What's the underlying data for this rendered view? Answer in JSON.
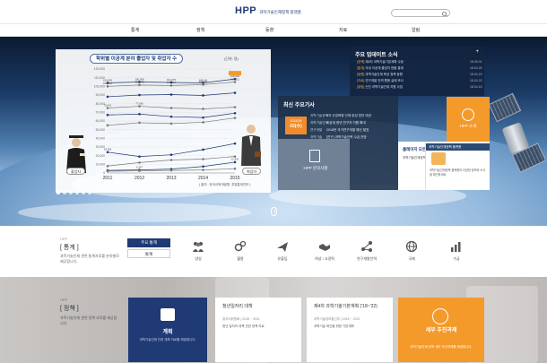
{
  "header": {
    "logo_mark": "HPP",
    "logo_sub": "과학기술인재정책 플랫폼"
  },
  "nav": {
    "items": [
      "통계",
      "정책",
      "동향",
      "자료",
      "알림"
    ]
  },
  "chart_panel": {
    "title": "학위별 이공계 분야 졸업자 및 취업자 수",
    "unit": "(단위: 명)",
    "source": "( 출처 : 한국교육개발원, 취업통계연보 )",
    "graduates_label": "졸업자",
    "employed_label": "취업자"
  },
  "chart_data": {
    "type": "line",
    "x": [
      "2011",
      "2012",
      "2013",
      "2014",
      "2015"
    ],
    "ylim": [
      0,
      120000
    ],
    "yticks": [
      "0",
      "10,000",
      "20,000",
      "30,000",
      "40,000",
      "50,000",
      "60,000",
      "70,000",
      "80,000",
      "90,000",
      "100,000",
      "110,000",
      "120,000"
    ],
    "series": [
      {
        "values": [
          104000,
          105000,
          104500,
          104000,
          108500
        ]
      },
      {
        "values": [
          100000,
          101500,
          101000,
          102000,
          105000
        ]
      },
      {
        "values": [
          88000,
          90000,
          90500,
          89500,
          92500
        ]
      },
      {
        "values": [
          75000,
          77000,
          75000,
          74000,
          76000
        ]
      },
      {
        "values": [
          67000,
          68000,
          65000,
          64000,
          69000
        ]
      },
      {
        "values": [
          55000,
          58000,
          57000,
          58500,
          63500
        ]
      },
      {
        "values": [
          24000,
          19000,
          21000,
          27000,
          34000
        ]
      },
      {
        "values": [
          8000,
          12000,
          15000,
          16000,
          19000
        ]
      },
      {
        "values": [
          3000,
          3500,
          4500,
          7500,
          12500
        ]
      },
      {
        "values": [
          2000,
          2500,
          3000,
          3500,
          5000
        ]
      }
    ],
    "point_labels": [
      [
        "104,000",
        "105,008",
        "104,475",
        "104,111",
        "108,548"
      ],
      [
        "100,052",
        "101,475",
        "101,011",
        "102,041",
        "105,011"
      ],
      [],
      [
        "75,041",
        "77,036",
        "",
        "",
        ""
      ],
      [],
      [],
      [
        "24,118",
        "",
        "",
        "",
        ""
      ],
      [],
      [
        "",
        "5,247",
        "",
        "",
        "12,541"
      ],
      []
    ]
  },
  "updates": {
    "heading": "주요 업데이트 소식",
    "more": "+",
    "items": [
      {
        "tag": "[정책]",
        "text": "제4차 과학기술기본계획 수정",
        "date": "18.05.01"
      },
      {
        "tag": "[통계]",
        "text": "국내 이공계 졸업자 현황 통계",
        "date": "18.04.26"
      },
      {
        "tag": "[동향]",
        "text": "과학기술인재 육성 정책 동향",
        "date": "18.04.23"
      },
      {
        "tag": "[자료]",
        "text": "연구개발 인력 활용 실태 조사",
        "date": "18.04.20"
      },
      {
        "tag": "[알림]",
        "text": "신진 과학기술인재 지원 사업",
        "date": "18.04.18"
      }
    ]
  },
  "news": {
    "heading": "최신 주요기사",
    "date_year": "2018.05",
    "date_day": "03(수)",
    "items": [
      {
        "cat": "과학기술정책",
        "text": "4차 산업혁명 인재 양성 방안 마련"
      },
      {
        "cat": "과학기술인재",
        "text": "이공계 청년 연구자 지원 확대"
      },
      {
        "cat": "연구개발",
        "text": "2018년 국가연구개발 예산 발표"
      },
      {
        "cat": "과학기술",
        "text": "[연구] 과학기술인력 수급 전망"
      }
    ]
  },
  "hpp_board": {
    "label": "HPP 문의사항"
  },
  "hpp_square": {
    "label": "HPP 소개"
  },
  "white_card": {
    "title": "콜레이지 모든 안내",
    "text": "과학기술인재정책 플랫폼 이용 안내"
  },
  "promo": {
    "top": "과학기술인재정책 플랫폼",
    "text": "과학기술인재정책 플랫폼의 다양한 정보와 소식을 확인하세요"
  },
  "stats_section": {
    "label_sm": "HPP",
    "title": "[ 통계 ]",
    "desc": "과학기술인재 관련 통계자료를 분야별로 제공합니다.",
    "tab_active": "주요 통계",
    "tab_plain": "통계",
    "categories": [
      {
        "icon": "people-icon",
        "label": "양성"
      },
      {
        "icon": "gears-icon",
        "label": "활용"
      },
      {
        "icon": "plane-icon",
        "label": "유출입"
      },
      {
        "icon": "handshake-icon",
        "label": "여성 / 고경력"
      },
      {
        "icon": "network-icon",
        "label": "연구개발인력"
      },
      {
        "icon": "globe-icon",
        "label": "국제"
      },
      {
        "icon": "bar-chart-icon",
        "label": "수급"
      }
    ]
  },
  "policy_section": {
    "label_sm": "HPP",
    "title": "[ 정책 ]",
    "desc": "과학기술인재 관련 정책 자료를 제공합니다.",
    "plan_card": {
      "title": "계획",
      "desc": "과학기술인재 관련 계획 자료를 제공합니다."
    },
    "card1": {
      "title": "청년일자리 대책",
      "sub": "일자리위원회 | 2018 ~ 2021",
      "text": "청년 일자리 대책 관련 정책 자료"
    },
    "card2": {
      "title": "제4차 과학기술기본계획 ('18~'22)",
      "sub": "과학기술정보통신부 | 2018 ~ 2022",
      "text": "과학기술 혁신을 위한 기본계획"
    },
    "tax_card": {
      "title": "세부 추진과제",
      "desc": "과학기술인재 정책 세부 추진과제를 제공합니다."
    }
  },
  "colors": {
    "navy": "#1f3a74",
    "orange": "#f39a2b",
    "graduate_line": "#1f3a74",
    "employed_line": "#7a7a7a"
  }
}
